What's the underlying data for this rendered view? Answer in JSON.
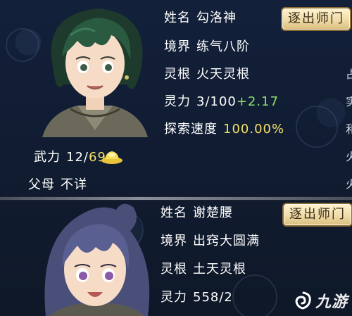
{
  "cards": [
    {
      "name_label": "姓名",
      "name": "勾洛神",
      "expel_button": "逐出师门",
      "realm_label": "境界",
      "realm": "练气八阶",
      "root_label": "灵根",
      "root": "火天灵根",
      "power_label": "灵力",
      "power_value": "3/100",
      "power_bonus": "+2.17",
      "explore_label": "探索速度",
      "explore_value": "100.00%",
      "force_label": "武力",
      "force_current": "12/",
      "force_max": "69",
      "parents_label": "父母",
      "parents": "不详",
      "edge_chars": [
        "",
        "占",
        "实",
        "和",
        "火",
        "火"
      ]
    },
    {
      "name_label": "姓名",
      "name": "谢楚腰",
      "expel_button": "逐出师门",
      "realm_label": "境界",
      "realm": "出窍大圆满",
      "root_label": "灵根",
      "root": "土天灵根",
      "power_label": "灵力",
      "power_value": "558/2"
    }
  ],
  "watermark": {
    "text": "九游"
  },
  "colors": {
    "background": "#0f1a2c",
    "gold_text": "#f4e06a",
    "green_text": "#8fe070",
    "button_fill": "#f0dcaa"
  },
  "icons": {
    "force_badge": "gold-ingot-icon",
    "watermark_logo": "jiuyou-logo-icon"
  }
}
